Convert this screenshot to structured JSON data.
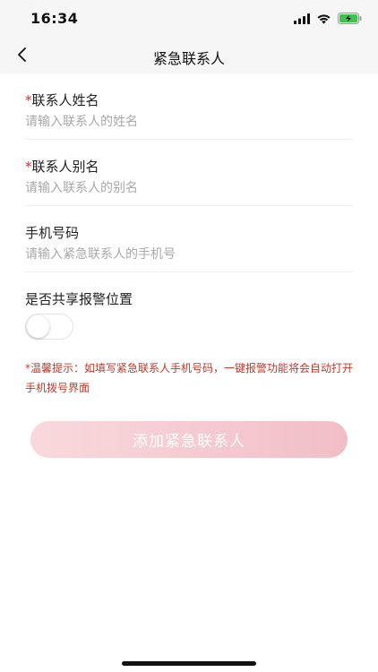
{
  "status_bar": {
    "time": "16:34"
  },
  "nav": {
    "title": "紧急联系人"
  },
  "form": {
    "name": {
      "required_mark": "*",
      "label": "联系人姓名",
      "placeholder": "请输入联系人的姓名",
      "value": ""
    },
    "alias": {
      "required_mark": "*",
      "label": "联系人别名",
      "placeholder": "请输入联系人的别名",
      "value": ""
    },
    "phone": {
      "label": "手机号码",
      "placeholder": "请输入紧急联系人的手机号",
      "value": ""
    },
    "share_location": {
      "label": "是否共享报警位置",
      "enabled": false
    }
  },
  "hint": {
    "text": "*温馨提示：如填写紧急联系人手机号码，一键报警功能将会自动打开手机拨号界面"
  },
  "actions": {
    "add_label": "添加紧急联系人"
  },
  "colors": {
    "accent": "#f1bec6",
    "hint": "#c0392b",
    "required": "#d0312d"
  },
  "icons": {
    "back": "chevron-left-icon",
    "signal": "signal-icon",
    "wifi": "wifi-icon",
    "battery": "battery-charging-icon"
  }
}
